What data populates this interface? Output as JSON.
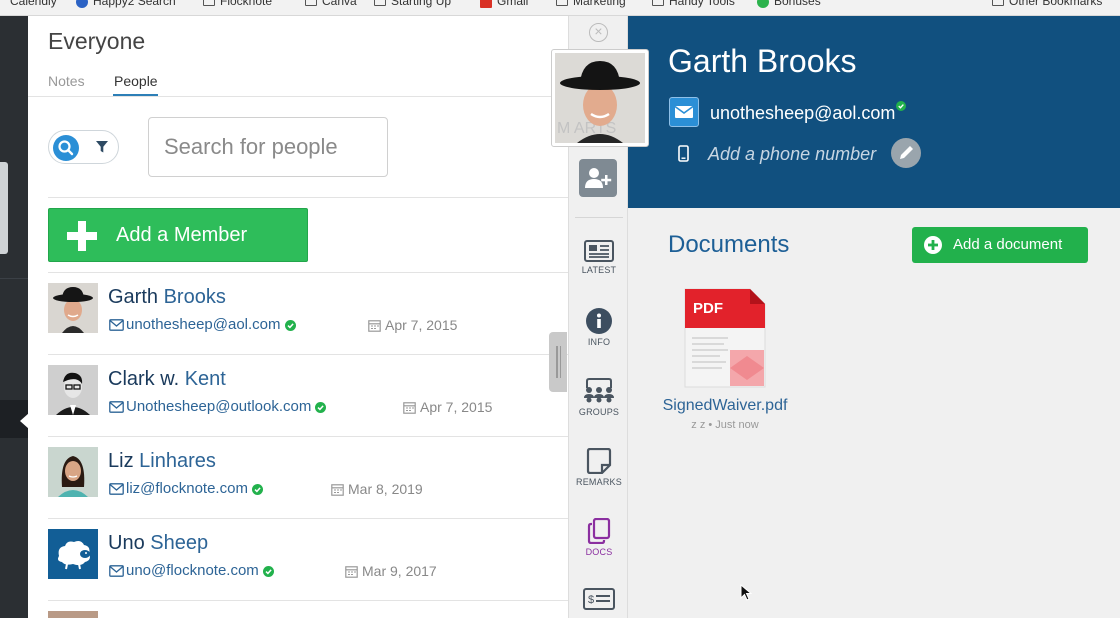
{
  "bookmarks": [
    {
      "label": "Calendly",
      "icon": "folder"
    },
    {
      "label": "Happy2 Search",
      "icon": "dot-blue"
    },
    {
      "label": "Flocknote",
      "icon": "folder"
    },
    {
      "label": "Canva",
      "icon": "folder"
    },
    {
      "label": "Starting Up",
      "icon": "folder"
    },
    {
      "label": "Gmail",
      "icon": "gmail"
    },
    {
      "label": "Marketing",
      "icon": "folder"
    },
    {
      "label": "Handy Tools",
      "icon": "folder"
    },
    {
      "label": "Bonuses",
      "icon": "dot-green"
    },
    {
      "label": "Other Bookmarks",
      "icon": "folder"
    }
  ],
  "panel": {
    "title": "Everyone",
    "tabs": [
      {
        "label": "Notes"
      },
      {
        "label": "People"
      }
    ],
    "active_tab": "People",
    "search_placeholder": "Search for people",
    "add_member_label": "Add a Member"
  },
  "people": [
    {
      "first": "Garth",
      "last": "Brooks",
      "email": "unothesheep@aol.com",
      "verified": true,
      "date": "Apr 7, 2015",
      "avatar": "cowboy-photo"
    },
    {
      "first": "Clark w.",
      "last": "Kent",
      "email": "Unothesheep@outlook.com",
      "verified": true,
      "date": "Apr 7, 2015",
      "avatar": "bw-portrait"
    },
    {
      "first": "Liz",
      "last": "Linhares",
      "email": "liz@flocknote.com",
      "verified": true,
      "date": "Mar 8, 2019",
      "avatar": "woman-photo"
    },
    {
      "first": "Uno",
      "last": "Sheep",
      "email": "uno@flocknote.com",
      "verified": true,
      "date": "Mar 9, 2017",
      "avatar": "sheep-logo"
    }
  ],
  "sidenav": {
    "items": [
      {
        "label": "LATEST",
        "icon": "newspaper-icon"
      },
      {
        "label": "INFO",
        "icon": "info-icon"
      },
      {
        "label": "GROUPS",
        "icon": "groups-icon"
      },
      {
        "label": "REMARKS",
        "icon": "note-icon"
      },
      {
        "label": "DOCS",
        "icon": "docs-icon"
      }
    ],
    "active": "DOCS"
  },
  "profile": {
    "name": "Garth Brooks",
    "email": "unothesheep@aol.com",
    "email_verified": true,
    "phone_placeholder": "Add a phone number"
  },
  "documents": {
    "title": "Documents",
    "add_label": "Add a document",
    "files": [
      {
        "name": "SignedWaiver.pdf",
        "meta": "z z • Just now",
        "badge": "PDF"
      }
    ]
  },
  "colors": {
    "header_blue": "#11507f",
    "green": "#2ebd5a",
    "link_blue": "#2d6496",
    "active_purple": "#8b2fa0",
    "pdf_red": "#e2222b"
  }
}
